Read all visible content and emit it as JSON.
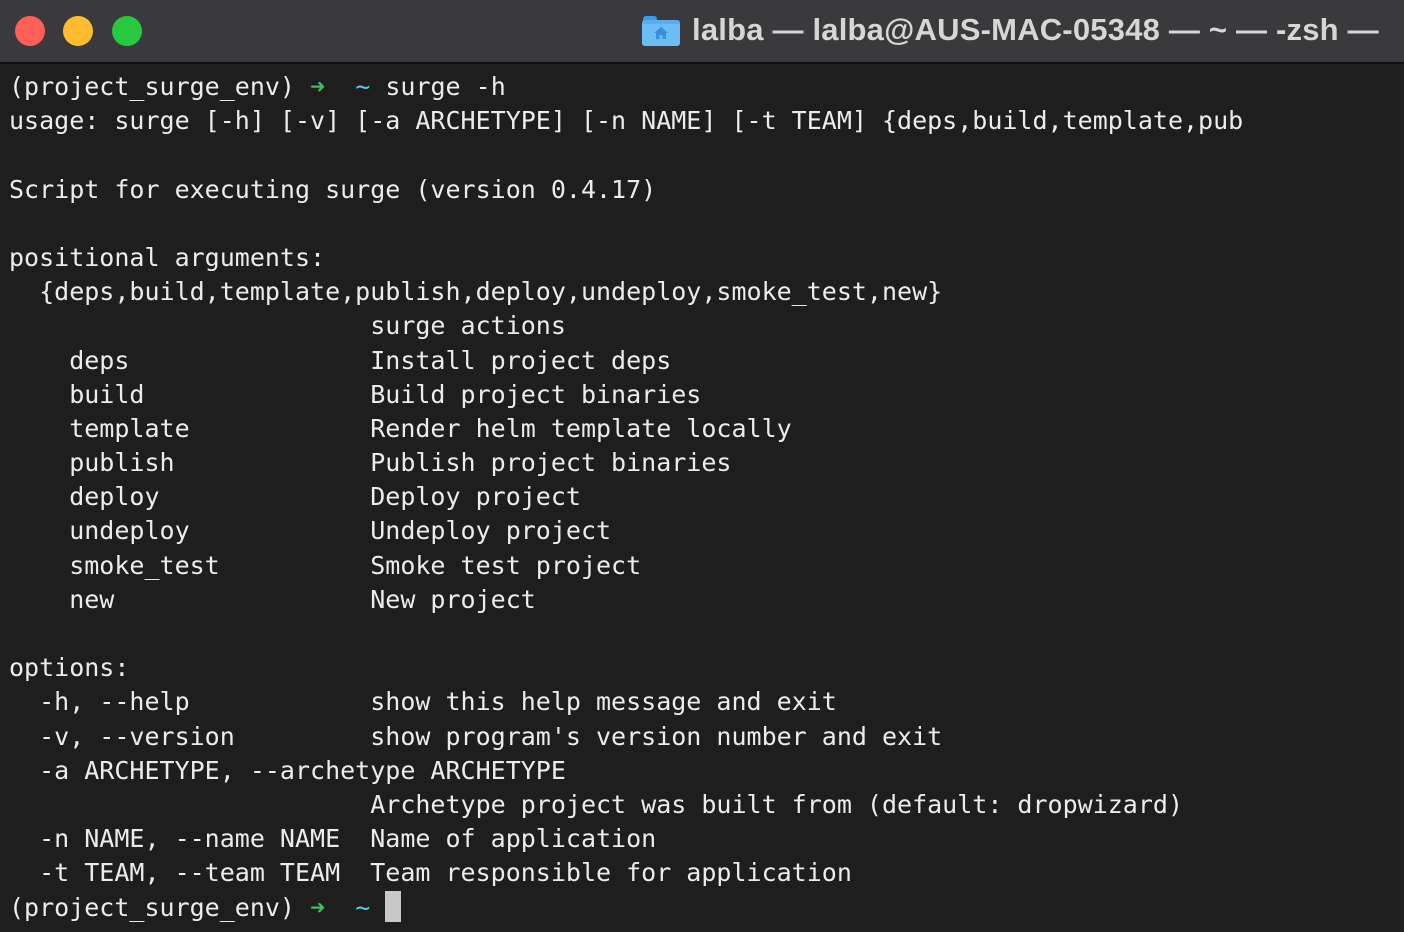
{
  "window": {
    "title": "lalba — lalba@AUS-MAC-05348 — ~ — -zsh —",
    "colors": {
      "red": "#fe5f57",
      "yellow": "#febc2e",
      "green": "#28c840"
    }
  },
  "terminal": {
    "prompt_env": "(project_surge_env)",
    "prompt_arrow": "➜",
    "prompt_dir": "~",
    "command": "surge -h",
    "lines": [
      "usage: surge [-h] [-v] [-a ARCHETYPE] [-n NAME] [-t TEAM] {deps,build,template,pub",
      "",
      "Script for executing surge (version 0.4.17)",
      "",
      "positional arguments:",
      "  {deps,build,template,publish,deploy,undeploy,smoke_test,new}",
      "                        surge actions",
      "    deps                Install project deps",
      "    build               Build project binaries",
      "    template            Render helm template locally",
      "    publish             Publish project binaries",
      "    deploy              Deploy project",
      "    undeploy            Undeploy project",
      "    smoke_test          Smoke test project",
      "    new                 New project",
      "",
      "options:",
      "  -h, --help            show this help message and exit",
      "  -v, --version         show program's version number and exit",
      "  -a ARCHETYPE, --archetype ARCHETYPE",
      "                        Archetype project was built from (default: dropwizard)",
      "  -n NAME, --name NAME  Name of application",
      "  -t TEAM, --team TEAM  Team responsible for application"
    ],
    "accent_colors": {
      "arrow": "#3cc05a",
      "dir": "#5cc8ee"
    }
  }
}
